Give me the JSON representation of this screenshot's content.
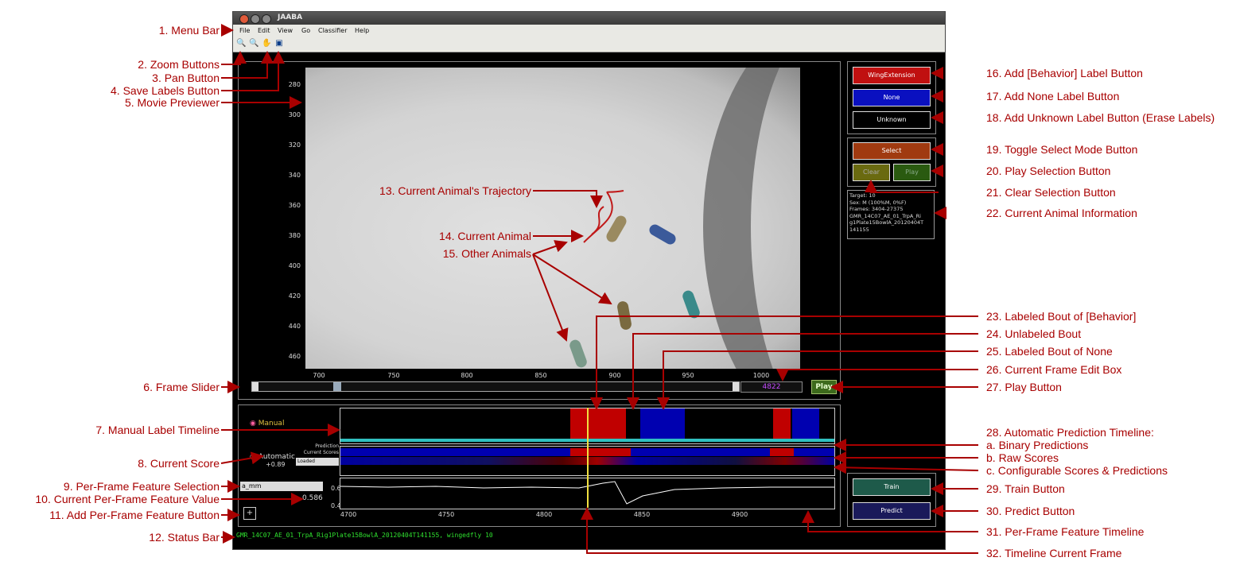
{
  "window": {
    "title": "JAABA",
    "menu": [
      "File",
      "Edit",
      "View",
      "Go",
      "Classifier",
      "Help"
    ]
  },
  "movie": {
    "y_ticks": [
      "280",
      "300",
      "320",
      "340",
      "360",
      "380",
      "400",
      "420",
      "440",
      "460"
    ],
    "x_ticks": [
      "700",
      "750",
      "800",
      "850",
      "900",
      "950",
      "1000"
    ]
  },
  "controls": {
    "frame_value": "4822",
    "play_label": "Play"
  },
  "label_buttons": {
    "behavior": "WingExtension",
    "none": "None",
    "unknown": "Unknown",
    "select": "Select",
    "clear": "Clear",
    "play": "Play"
  },
  "animal_info": {
    "target": "Target: 10",
    "sex": "Sex: M (100%M, 0%F)",
    "frames": "Frames: 3404-27375",
    "exp": "GMR_14C07_AE_01_TrpA_Ri\ng1Plate15BowlA_20120404T\n141155"
  },
  "timeline": {
    "manual_label": "Manual",
    "automatic_label": "Automatic",
    "prediction_label": "Prediction",
    "current_scores_label": "Current Scores",
    "scores_dropdown": "Loaded",
    "current_score": "+0.89",
    "feature_select": "a_mm",
    "feature_value": "0.586",
    "feature_y_top": "0.6",
    "feature_y_bottom": "0.4",
    "add_feature": "+",
    "x_ticks": [
      "4700",
      "4750",
      "4800",
      "4850",
      "4900"
    ]
  },
  "train_predict": {
    "train": "Train",
    "predict": "Predict"
  },
  "status_bar": "GMR_14C07_AE_01_TrpA_Rig1Plate15BowlA_20120404T141155, wingedfly 10",
  "callouts_left": [
    "1. Menu Bar",
    "2. Zoom Buttons",
    "3. Pan Button",
    "4. Save Labels Button",
    "5. Movie Previewer",
    "6. Frame Slider",
    "7. Manual Label Timeline",
    "8. Current Score",
    "9. Per-Frame Feature Selection",
    "10. Current Per-Frame Feature Value",
    "11. Add Per-Frame Feature Button",
    "12. Status Bar"
  ],
  "callouts_inner": [
    "13. Current Animal's Trajectory",
    "14. Current Animal",
    "15. Other Animals"
  ],
  "callouts_right": [
    "16. Add [Behavior] Label Button",
    "17. Add None Label Button",
    "18. Add Unknown Label Button (Erase Labels)",
    "19. Toggle Select Mode Button",
    "20. Play Selection Button",
    "21. Clear Selection Button",
    "22. Current Animal Information",
    "23. Labeled Bout of [Behavior]",
    "24. Unlabeled Bout",
    "25. Labeled Bout of None",
    "26. Current Frame Edit Box",
    "27. Play Button",
    "28. Automatic Prediction Timeline:",
    "a. Binary Predictions",
    "b. Raw Scores",
    "c. Configurable Scores & Predictions",
    "29. Train Button",
    "30. Predict Button",
    "31. Per-Frame Feature Timeline",
    "32. Timeline Current Frame"
  ],
  "colors": {
    "callout": "#a80000",
    "behavior": "#c00000",
    "none": "#0000b0",
    "status": "#2fe02f"
  }
}
